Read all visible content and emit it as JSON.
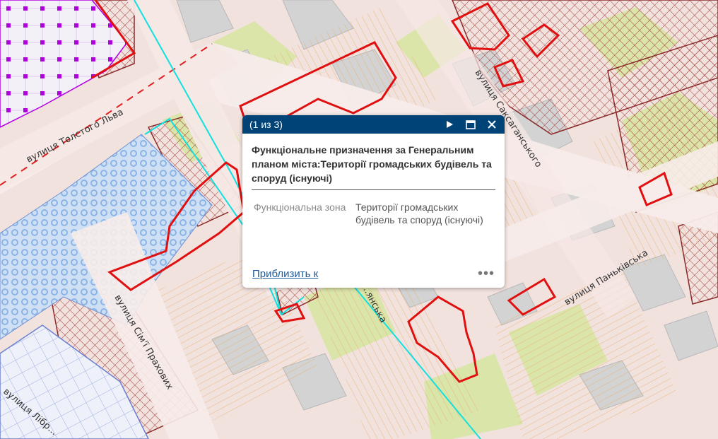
{
  "map": {
    "streets": [
      {
        "key": "tolstoho",
        "name": "вулиця Толстого Льва"
      },
      {
        "key": "saksahanskoho",
        "name": "вулиця Саксаганського"
      },
      {
        "key": "pankivska",
        "name": "вулиця Паньківська"
      },
      {
        "key": "prakhovykh",
        "name": "вулиця Сім'ї Прахових"
      },
      {
        "key": "liubetska",
        "name": "вулиця Лібр..."
      },
      {
        "key": "partial",
        "name": "...янська"
      }
    ]
  },
  "popup": {
    "counter": "(1 из 3)",
    "title": "Функціональне призначення за Генеральним планом міста:Території громадських будівель та споруд (існуючі)",
    "attribute_key": "Функціональна зона",
    "attribute_value": "Території громадських будівель та споруд (існуючі)",
    "zoom_link": "Приблизить к",
    "menu": "•••",
    "header_color": "#004376"
  },
  "colors": {
    "land": "#f2e2de",
    "road": "#f7ecea",
    "green": "#d8e6a4",
    "building": "#d3d3d3",
    "red_outline": "#e01010",
    "cyan": "#12e0e0",
    "purple": "#b000e0",
    "blue_dots": "#8ab4e8"
  }
}
